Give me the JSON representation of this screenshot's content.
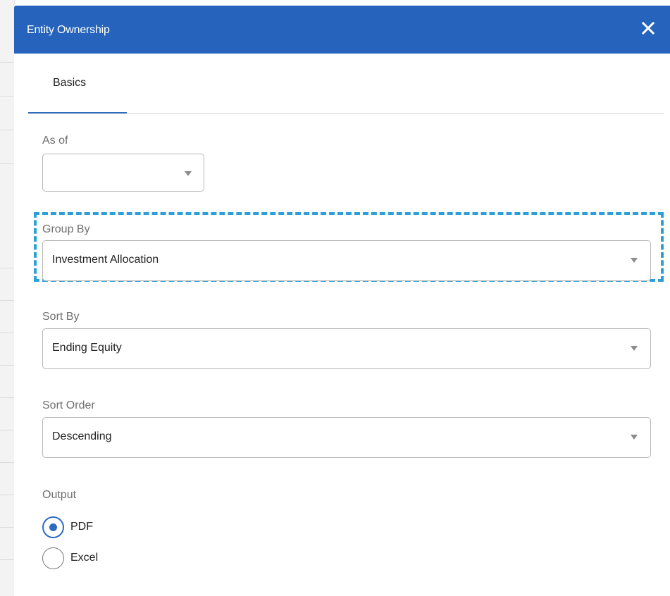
{
  "dialog": {
    "title": "Entity Ownership",
    "close_icon": "close-icon",
    "accent_color": "#2563bc"
  },
  "tabs": [
    {
      "label": "Basics",
      "active": true
    }
  ],
  "form": {
    "as_of": {
      "label": "As of",
      "value": ""
    },
    "group_by": {
      "label": "Group By",
      "value": "Investment Allocation"
    },
    "sort_by": {
      "label": "Sort By",
      "value": "Ending Equity"
    },
    "sort_order": {
      "label": "Sort Order",
      "value": "Descending"
    },
    "output": {
      "label": "Output",
      "options": [
        {
          "label": "PDF",
          "checked": true
        },
        {
          "label": "Excel",
          "checked": false
        }
      ]
    }
  }
}
